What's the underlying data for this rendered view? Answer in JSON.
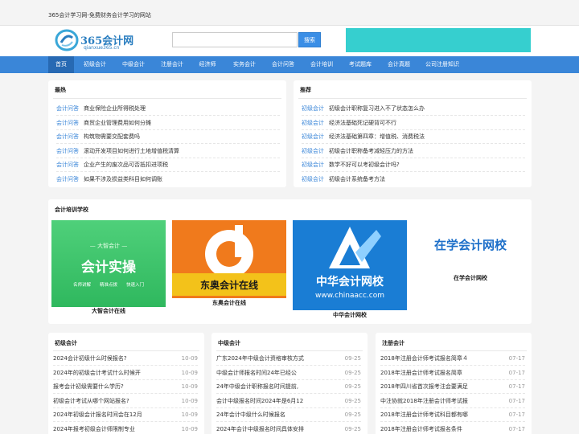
{
  "topbar": {
    "tagline": "365会计学习网-免费财务会计学习的网站"
  },
  "logo": {
    "name": "365会计网",
    "domain": "qianxue365.cn"
  },
  "search": {
    "placeholder": "",
    "button": "搜索"
  },
  "nav": [
    "首页",
    "初级会计",
    "中级会计",
    "注册会计",
    "经济师",
    "实务会计",
    "会计问答",
    "会计培训",
    "考试题库",
    "会计真题",
    "公司注册知识"
  ],
  "hot": {
    "title": "最热",
    "items": [
      {
        "cat": "会计问答",
        "title": "商业保险企业所得税处理"
      },
      {
        "cat": "会计问答",
        "title": "商贸企业管理费用如何分摊"
      },
      {
        "cat": "会计问答",
        "title": "构筑物需要交配套费吗"
      },
      {
        "cat": "会计问答",
        "title": "滚动开发项目如何进行土地增值税清算"
      },
      {
        "cat": "会计问答",
        "title": "企业产生的废次品可否抵扣进项税"
      },
      {
        "cat": "会计问答",
        "title": "如果不涉及损益类科目如何调账"
      }
    ]
  },
  "recommend": {
    "title": "推荐",
    "items": [
      {
        "cat": "初级会计",
        "title": "初级会计职称复习进入不了状态怎么办"
      },
      {
        "cat": "初级会计",
        "title": "经济法基础死记硬背可不行"
      },
      {
        "cat": "初级会计",
        "title": "经济法基础第四章：增值税、消费税法"
      },
      {
        "cat": "初级会计",
        "title": "初级会计职称备考减轻压力的方法"
      },
      {
        "cat": "初级会计",
        "title": "数学不好可以考初级会计吗?"
      },
      {
        "cat": "初级会计",
        "title": "初级会计系统备考方法"
      }
    ]
  },
  "schools": {
    "title": "会计培训学校",
    "items": [
      {
        "name": "大智会计在线",
        "banner_top": "— 大智会计 —",
        "banner_main": "会计实操",
        "banner_tags": "名师讲解　　精准点拨　　快速入门"
      },
      {
        "name": "东奥会计在线",
        "banner_main": "东奥会计在线"
      },
      {
        "name": "中华会计网校",
        "banner_main": "中华会计网校",
        "banner_url": "www.chinaacc.com"
      },
      {
        "name": "在学会计网校",
        "banner_main": "在学会计网校"
      }
    ]
  },
  "columns": [
    {
      "title": "初级会计",
      "items": [
        {
          "title": "2024会计初级什么时候报名?",
          "date": "10-09"
        },
        {
          "title": "2024年的初级会计考试什么时候开",
          "date": "10-09"
        },
        {
          "title": "报考会计初级需要什么学历?",
          "date": "10-09"
        },
        {
          "title": "初级会计考试从哪个网站报名?",
          "date": "10-09"
        },
        {
          "title": "2024年初级会计报名时间会在12月",
          "date": "10-09"
        },
        {
          "title": "2024年报考初级会计师限制专业",
          "date": "10-09"
        }
      ]
    },
    {
      "title": "中级会计",
      "items": [
        {
          "title": "广东2024年中级会计资格审核方式",
          "date": "09-25"
        },
        {
          "title": "中级会计师报名时间24年已经公",
          "date": "09-25"
        },
        {
          "title": "24年中级会计职称报名时间提前,",
          "date": "09-25"
        },
        {
          "title": "会计中级报名时间2024年是6月12",
          "date": "09-25"
        },
        {
          "title": "24年会计中级什么时候报名",
          "date": "09-25"
        },
        {
          "title": "2024年会计中级报名时间具体安排",
          "date": "09-25"
        }
      ]
    },
    {
      "title": "注册会计",
      "items": [
        {
          "title": "2018年注册会计师考试报名简章４",
          "date": "07-17"
        },
        {
          "title": "2018年注册会计师考试报名简章",
          "date": "07-17"
        },
        {
          "title": "2018年四川省首次报考注会要满足",
          "date": "07-17"
        },
        {
          "title": "中注协就2018年注册会计师考试报",
          "date": "07-17"
        },
        {
          "title": "2018年注册会计师考试科目都有哪",
          "date": "07-17"
        },
        {
          "title": "2018年注册会计师考试报名条件",
          "date": "07-17"
        }
      ]
    }
  ]
}
